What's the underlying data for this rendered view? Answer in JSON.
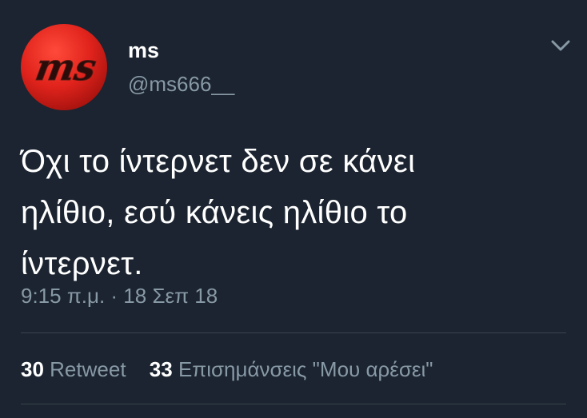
{
  "tweet": {
    "avatar_text": "ms",
    "display_name": "ms",
    "handle": "@ms666__",
    "text_lines": [
      "Όχι το ίντερνετ δεν σε κάνει",
      "ηλίθιο, εσύ κάνεις ηλίθιο το",
      "ίντερνετ."
    ],
    "timestamp": "9:15 π.μ. · 18 Σεπ 18",
    "stats": {
      "retweets_count": "30",
      "retweets_label": "Retweet",
      "likes_count": "33",
      "likes_label": "Επισημάνσεις \"Μου αρέσει\""
    }
  },
  "icons": {
    "menu": "chevron-down-icon"
  },
  "colors": {
    "background": "#1b2430",
    "primary_text": "#ffffff",
    "secondary_text": "#8899a6",
    "divider": "#38444d",
    "avatar_red": "#e0231c"
  }
}
